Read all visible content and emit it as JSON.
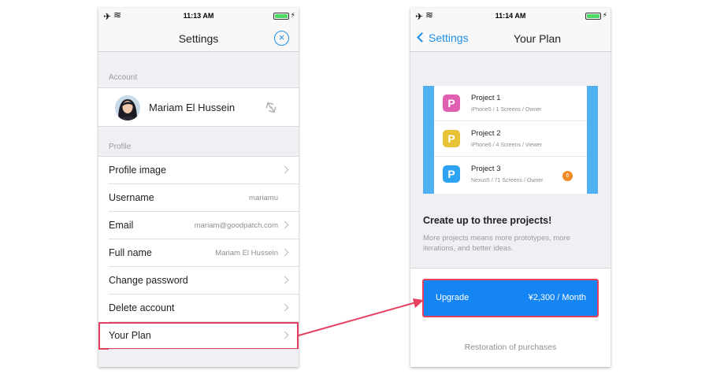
{
  "left_screen": {
    "status": {
      "time": "11:13 AM"
    },
    "nav": {
      "title": "Settings",
      "close_icon": "×"
    },
    "account_section": "Account",
    "account": {
      "name": "Mariam El Hussein"
    },
    "profile_section": "Profile",
    "rows": [
      {
        "label": "Profile image",
        "value": ""
      },
      {
        "label": "Username",
        "value": "mariamu"
      },
      {
        "label": "Email",
        "value": "mariam@goodpatch.com"
      },
      {
        "label": "Full name",
        "value": "Mariam El Hussein"
      },
      {
        "label": "Change password",
        "value": ""
      },
      {
        "label": "Delete account",
        "value": ""
      },
      {
        "label": "Your Plan",
        "value": ""
      }
    ]
  },
  "right_screen": {
    "status": {
      "time": "11:14 AM"
    },
    "nav": {
      "back_label": "Settings",
      "title": "Your Plan"
    },
    "projects": [
      {
        "name": "Project 1",
        "meta": "iPhone5 / 1 Screens / Owner",
        "color": "#e05fb0",
        "badge": ""
      },
      {
        "name": "Project 2",
        "meta": "iPhone6 / 4 Screens / Viewer",
        "color": "#e8c236",
        "badge": ""
      },
      {
        "name": "Project 3",
        "meta": "Nexus5 / 71 Screens / Owner",
        "color": "#2ea3f2",
        "badge": "6"
      }
    ],
    "promo_title": "Create up to three projects!",
    "promo_desc": "More projects means more prototypes, more iterations, and better ideas.",
    "upgrade": {
      "label": "Upgrade",
      "price": "¥2,300 / Month"
    },
    "restore_label": "Restoration of purchases"
  },
  "colors": {
    "accent": "#1e8fe9",
    "highlight": "#e5405e",
    "upgrade_bg": "#1485f2",
    "illustration_bg": "#4fb1f2"
  },
  "icons": {
    "status_plane": "airplane-icon",
    "status_wifi": "wifi-icon",
    "close": "close-circle-icon",
    "sync": "sync-icon",
    "chevron": "chevron-right-icon",
    "back": "chevron-left-icon",
    "project": "project-p-icon"
  }
}
